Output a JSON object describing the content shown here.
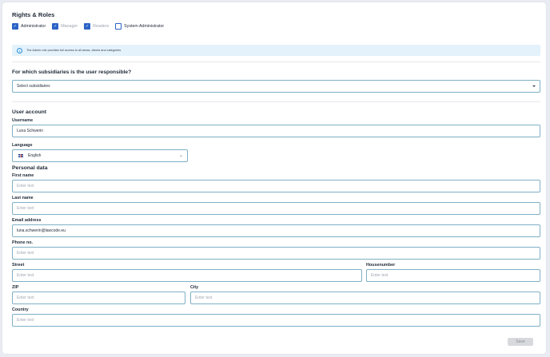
{
  "rights": {
    "title": "Rights & Roles",
    "roles": [
      {
        "label": "Administrator",
        "checked": true,
        "enabled": true
      },
      {
        "label": "Manager",
        "checked": true,
        "enabled": false
      },
      {
        "label": "Readers",
        "checked": true,
        "enabled": false
      },
      {
        "label": "System Administrator",
        "checked": false,
        "enabled": true
      }
    ],
    "info": "The Admin role provides full access to all areas, clients and categories"
  },
  "subsidiaries": {
    "question": "For which subsidiaries is the user responsible?",
    "select_label": "Select subsidiaries"
  },
  "account": {
    "title": "User account",
    "username_label": "Username",
    "username_value": "Luna Schwerin",
    "language_label": "Language",
    "language_value": "English"
  },
  "personal": {
    "title": "Personal data",
    "first_name_label": "First name",
    "last_name_label": "Last name",
    "email_label": "Email address",
    "email_value": "luna.schwerin@lawcode.eu",
    "phone_label": "Phone no.",
    "street_label": "Street",
    "housenumber_label": "Housenumber",
    "zip_label": "ZIP",
    "city_label": "City",
    "country_label": "Country",
    "placeholder": "Enter text"
  },
  "actions": {
    "save_label": "Save"
  },
  "colors": {
    "accent": "#2b63c6",
    "field_border": "#7fb0c5",
    "info_bg": "#e3f2fb"
  }
}
